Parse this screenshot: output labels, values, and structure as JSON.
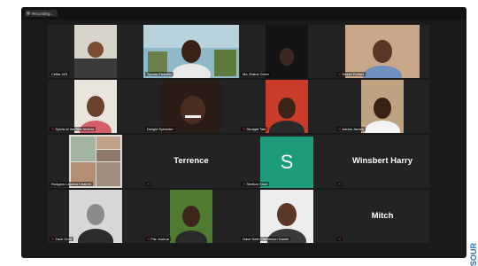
{
  "window": {
    "recording_label": "Recording..."
  },
  "participants": [
    {
      "name": "Cellar 423",
      "muted": false
    },
    {
      "name": "Tyrone Fletcher",
      "muted": false,
      "active_speaker": true
    },
    {
      "name": "Ms. Elaine Greer",
      "muted": false
    },
    {
      "name": "Susan Forbes",
      "muted": true
    },
    {
      "name": "Sylvia of the Sea Nickels",
      "muted": true
    },
    {
      "name": "Dwight Sylvester",
      "muted": false
    },
    {
      "name": "Straight Talk",
      "muted": true
    },
    {
      "name": "Adrian James",
      "muted": true
    },
    {
      "name": "Rodgers Laurent Chatrell",
      "muted": false
    },
    {
      "name": "Terrence",
      "muted": true,
      "display_text": "Terrence"
    },
    {
      "name": "Shelton Stout",
      "muted": true,
      "avatar_letter": "S"
    },
    {
      "name": "Winsbert Harry",
      "muted": true,
      "display_text": "Winsbert Harry"
    },
    {
      "name": "Zach Gold",
      "muted": true
    },
    {
      "name": "Fitz Joshua",
      "muted": true
    },
    {
      "name": "Dave Keith Cleminson Daniel",
      "muted": false
    },
    {
      "name": "Mitch",
      "muted": true,
      "display_text": "Mitch"
    }
  ],
  "side_text": "SOUR",
  "colors": {
    "window_bg": "#1a1a1a",
    "tile_bg": "#232323",
    "active_outline": "#d9e24a",
    "avatar_bg": "#1d9c7d",
    "muted_red": "#e33b3b"
  }
}
